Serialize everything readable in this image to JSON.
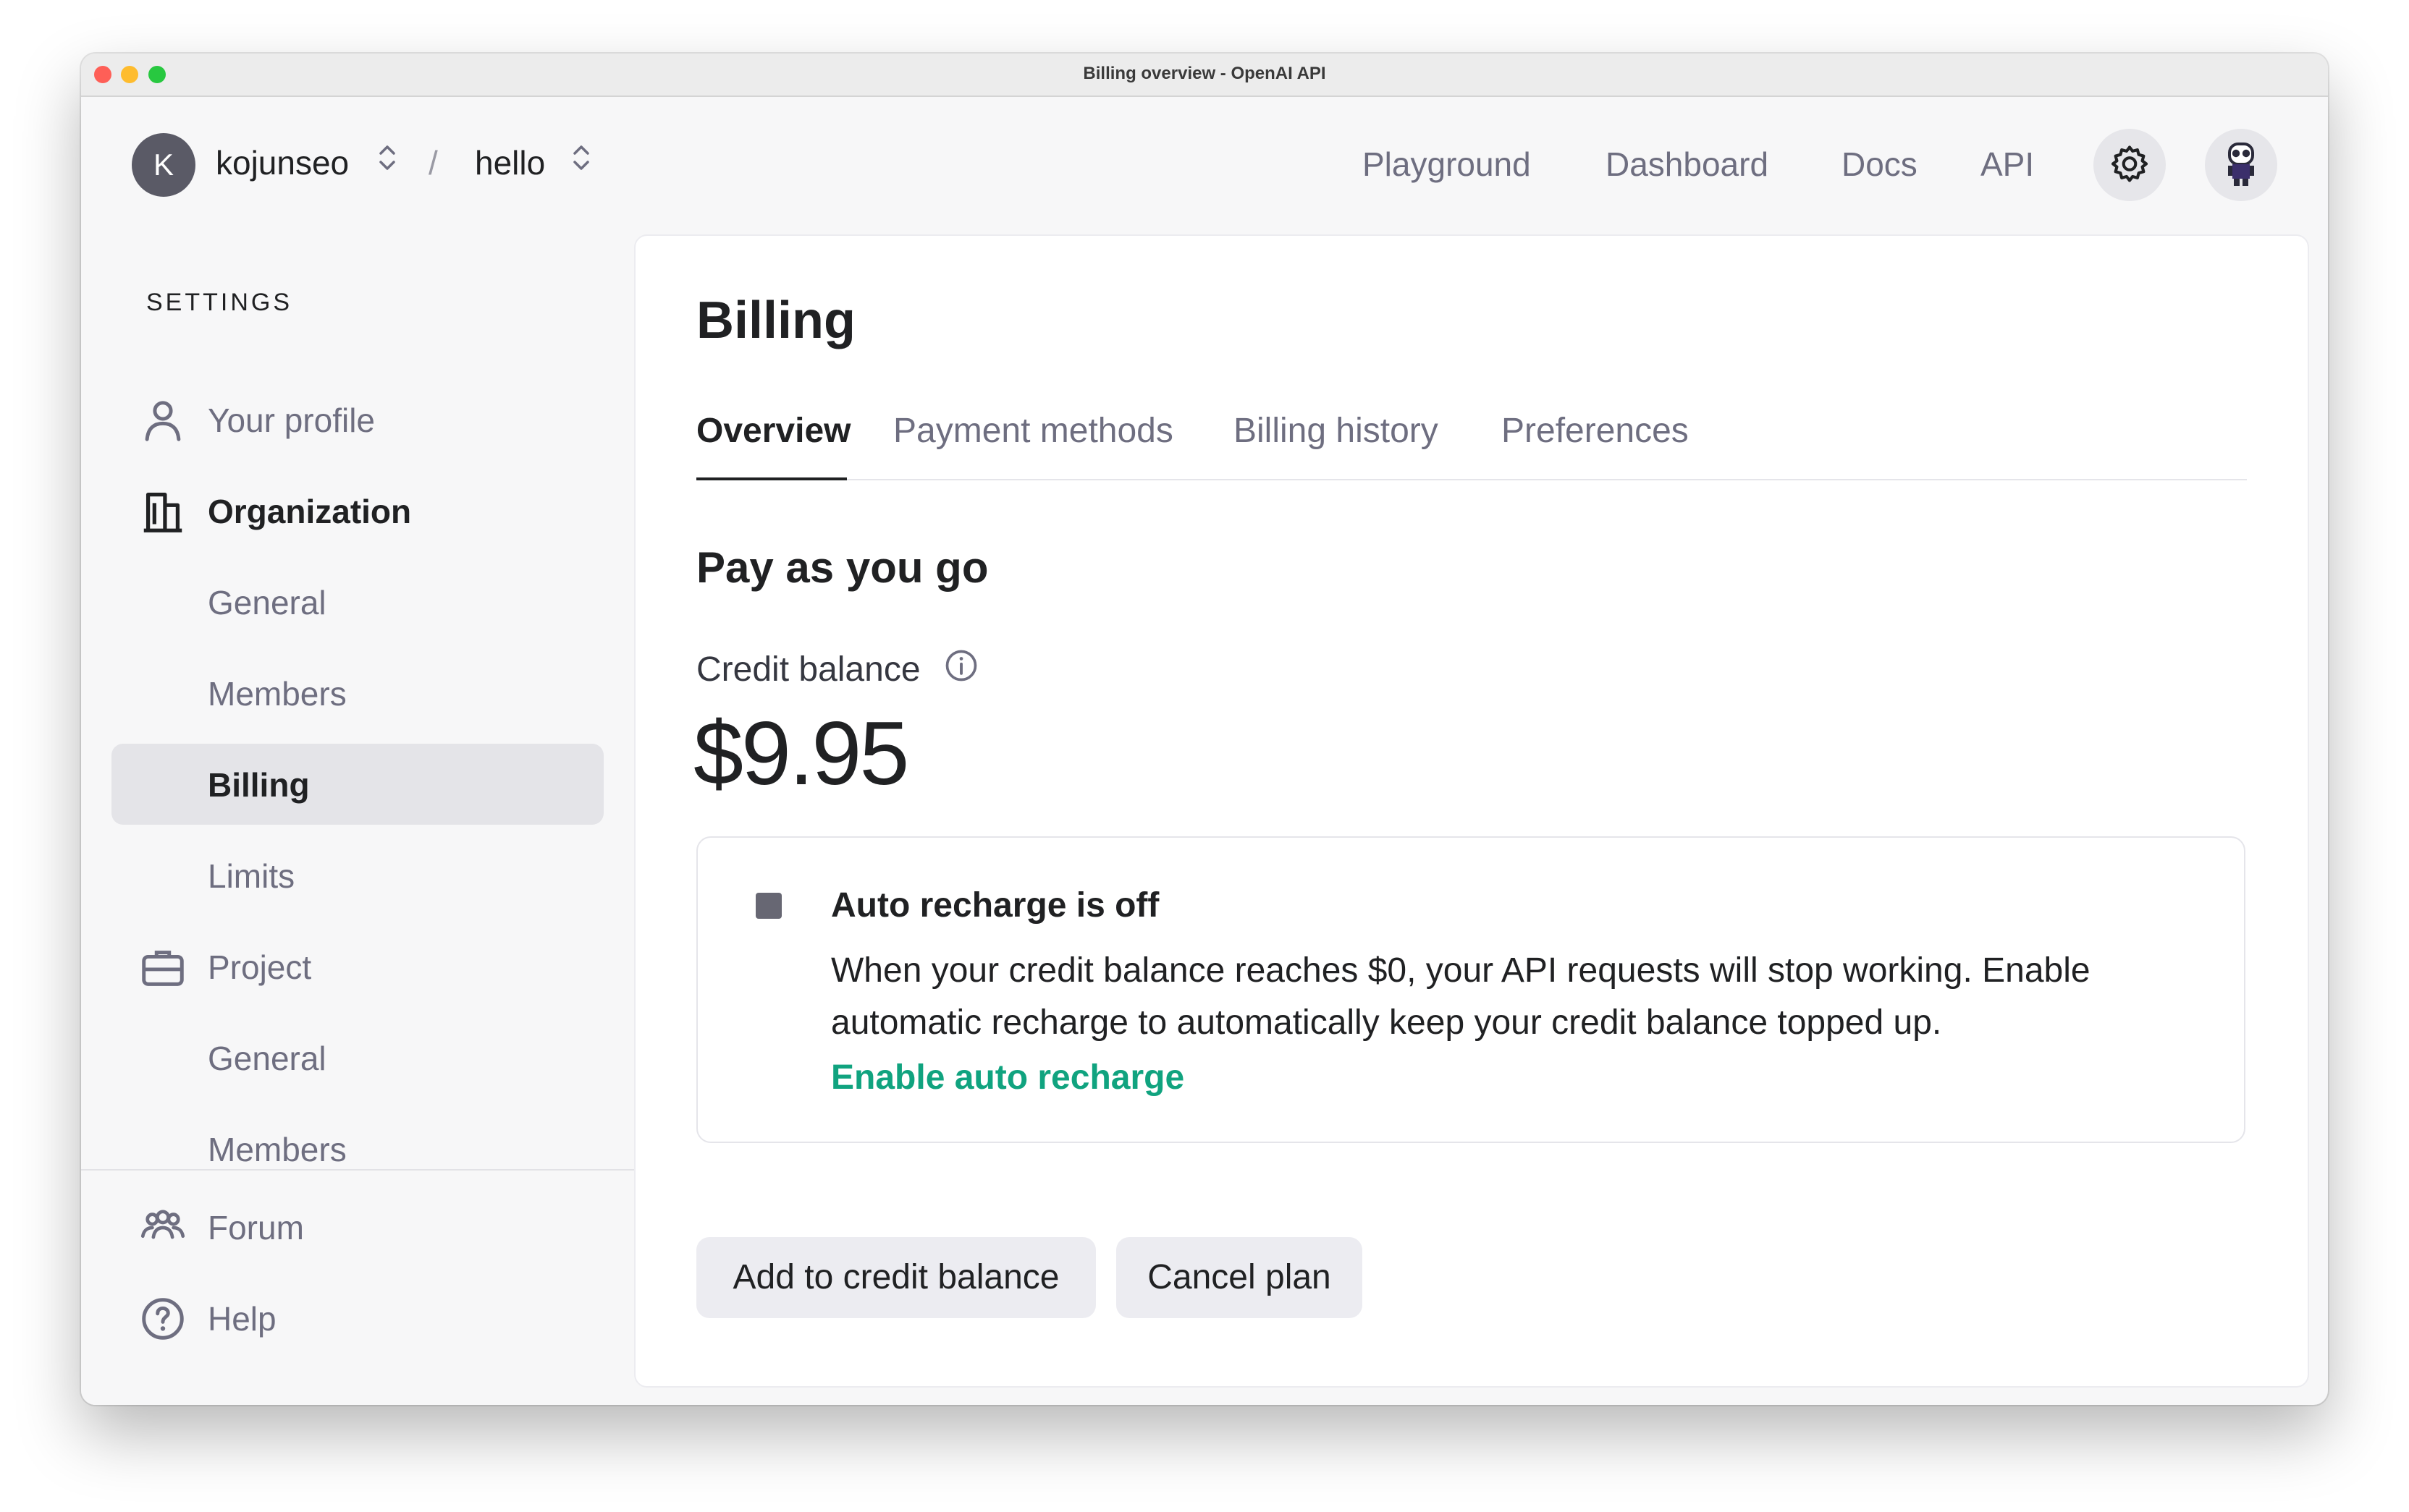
{
  "window": {
    "title": "Billing overview - OpenAI API"
  },
  "header": {
    "org_initial": "K",
    "org_name": "kojunseo",
    "separator": "/",
    "project_name": "hello",
    "nav": [
      {
        "label": "Playground"
      },
      {
        "label": "Dashboard"
      },
      {
        "label": "Docs"
      },
      {
        "label": "API"
      }
    ],
    "settings_icon": "gear-icon",
    "avatar_icon": "user-avatar"
  },
  "sidebar": {
    "heading": "SETTINGS",
    "items": [
      {
        "label": "Your profile",
        "icon": "person-icon"
      },
      {
        "label": "Organization",
        "icon": "building-icon"
      },
      {
        "label": "General"
      },
      {
        "label": "Members"
      },
      {
        "label": "Billing",
        "active": true
      },
      {
        "label": "Limits"
      },
      {
        "label": "Project",
        "icon": "briefcase-icon"
      },
      {
        "label": "General"
      },
      {
        "label": "Members"
      }
    ],
    "footer": [
      {
        "label": "Forum",
        "icon": "people-icon"
      },
      {
        "label": "Help",
        "icon": "help-icon"
      }
    ]
  },
  "main": {
    "title": "Billing",
    "tabs": [
      {
        "label": "Overview",
        "active": true
      },
      {
        "label": "Payment methods"
      },
      {
        "label": "Billing history"
      },
      {
        "label": "Preferences"
      }
    ],
    "plan_heading": "Pay as you go",
    "credit_label": "Credit balance",
    "credit_value": "$9.95",
    "notice": {
      "title": "Auto recharge is off",
      "body": "When your credit balance reaches $0, your API requests will stop working. Enable automatic recharge to automatically keep your credit balance topped up.",
      "link": "Enable auto recharge"
    },
    "buttons": {
      "add_credit": "Add to credit balance",
      "cancel_plan": "Cancel plan"
    }
  },
  "colors": {
    "accent_green": "#10a37f",
    "text_primary": "#202123",
    "text_secondary": "#6e6e80",
    "active_bg": "#e4e4e8"
  }
}
